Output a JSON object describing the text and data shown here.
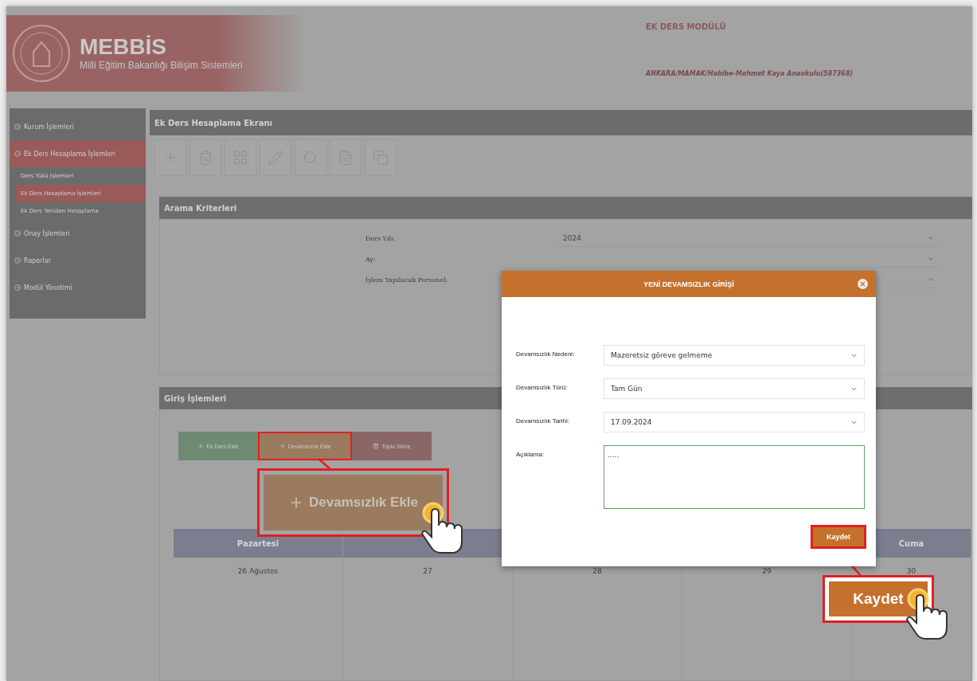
{
  "header": {
    "logo_title": "MEBBİS",
    "logo_subtitle": "Milli Eğitim Bakanlığı Bilişim Sistemleri",
    "module": "EK DERS MODÜLÜ",
    "institution": "ANKARA/MAMAK/Habibe-Mehmet Kaya Anaokulu(587368)"
  },
  "sidebar": {
    "items": [
      {
        "label": "Kurum İşlemleri",
        "selected": false
      },
      {
        "label": "Ek Ders Hesaplama İşlemleri",
        "selected": true,
        "children": [
          {
            "label": "Ders Yükü İşlemleri",
            "selected": false
          },
          {
            "label": "Ek Ders Hesaplama İşlemleri",
            "selected": true
          },
          {
            "label": "Ek Ders Yeniden Hesaplama",
            "selected": false
          }
        ]
      },
      {
        "label": "Onay İşlemleri",
        "selected": false
      },
      {
        "label": "Raporlar",
        "selected": false
      },
      {
        "label": "Modül Yönetimi",
        "selected": false
      }
    ]
  },
  "page_title": "Ek Ders Hesaplama Ekranı",
  "toolbar": [
    {
      "kind": "add"
    },
    {
      "kind": "delete"
    },
    {
      "kind": "grid"
    },
    {
      "kind": "edit"
    },
    {
      "kind": "search"
    },
    {
      "kind": "document"
    },
    {
      "kind": "copy"
    }
  ],
  "search": {
    "title": "Arama Kriterleri",
    "fields": [
      {
        "label": "Ders Yılı:",
        "value": "2024"
      },
      {
        "label": "Ay:"
      },
      {
        "label": "İşlem Yapılacak Personel:"
      }
    ]
  },
  "entry": {
    "title": "Giriş İşlemleri",
    "buttons": [
      {
        "label": "Ek Ders Ekle",
        "kind": "add",
        "color": "#6f8a72",
        "highlighted": false
      },
      {
        "label": "Devamsızlık Ekle",
        "kind": "add",
        "color": "#9a7b60",
        "highlighted": true
      },
      {
        "label": "Toplu Silme",
        "kind": "delete",
        "color": "#8a6666",
        "highlighted": false
      }
    ]
  },
  "calendar": {
    "columns": [
      "Pazartesi",
      null,
      null,
      null,
      "Cuma"
    ],
    "rows": [
      [
        "26 Ağustos",
        "27",
        "28",
        "29",
        "30"
      ]
    ]
  },
  "modal": {
    "title": "YENİ DEVAMSIZLIK GİRİŞİ",
    "fields": [
      {
        "label": "Devamsızlık Nedeni:",
        "value": "Mazeretsiz göreve gelmeme",
        "kind": "select"
      },
      {
        "label": "Devamsızlık Türü:",
        "value": "Tam Gün",
        "kind": "select"
      },
      {
        "label": "Devamsızlık Tarihi:",
        "value": "17.09.2024",
        "kind": "select"
      },
      {
        "label": "Açıklama:",
        "value": ".....",
        "kind": "textarea"
      }
    ],
    "save_button": {
      "label": "Kaydet",
      "highlighted": true
    }
  },
  "callouts": [
    {
      "label": "Devamsızlık Ekle",
      "kind": "add"
    },
    {
      "label": "Kaydet",
      "kind": "save"
    }
  ]
}
